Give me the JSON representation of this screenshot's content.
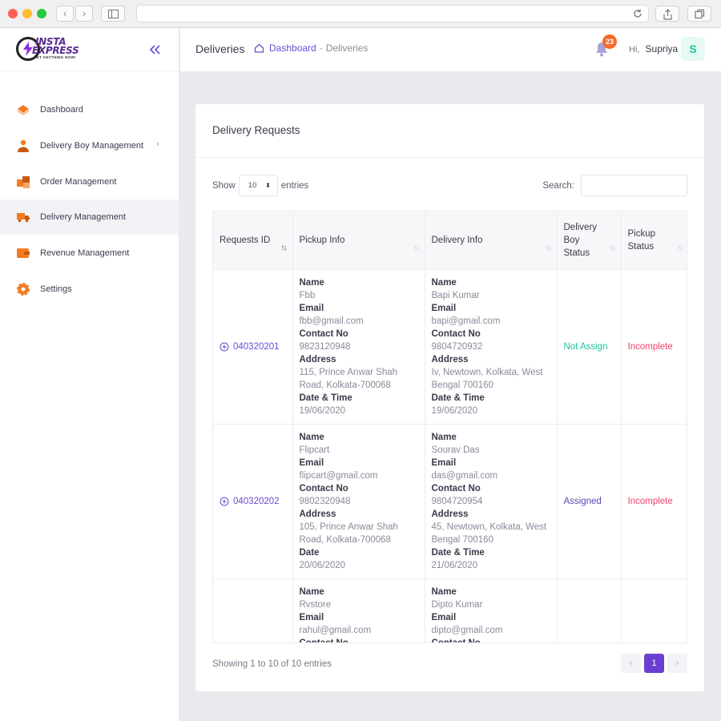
{
  "brand": {
    "line1": "INSTA",
    "line2": "EXPRESS",
    "tagline": "GET ANYTHING NOW!"
  },
  "sidebar": {
    "items": [
      {
        "label": "Dashboard",
        "icon": "diamond-icon",
        "color": "#f47a20"
      },
      {
        "label": "Delivery Boy Management",
        "icon": "delivery-boy-icon",
        "color": "#f47a20",
        "arrow": "›"
      },
      {
        "label": "Order Management",
        "icon": "boxes-icon",
        "color": "#f47a20"
      },
      {
        "label": "Delivery Management",
        "icon": "truck-icon",
        "color": "#f47a20"
      },
      {
        "label": "Revenue Management",
        "icon": "wallet-icon",
        "color": "#f47a20"
      },
      {
        "label": "Settings",
        "icon": "gear-icon",
        "color": "#f47a20"
      }
    ]
  },
  "header": {
    "title": "Deliveries",
    "breadcrumb_link": "Dashboard",
    "breadcrumb_sep": "-",
    "breadcrumb_current": "Deliveries",
    "notification_count": "23",
    "greeting": "Hi,",
    "user_name": "Supriya",
    "avatar_initial": "S"
  },
  "card": {
    "title": "Delivery Requests",
    "show_label": "Show",
    "entries_label": "entries",
    "page_length": "10",
    "search_label": "Search:",
    "search_value": "",
    "showing_text": "Showing 1 to 10 of 10 entries",
    "current_page": "1"
  },
  "table": {
    "headers": {
      "request_id": "Requests ID",
      "pickup": "Pickup Info",
      "delivery": "Delivery Info",
      "boy_status_1": "Delivery",
      "boy_status_2": "Boy",
      "boy_status_3": "Status",
      "pickup_status_1": "Pickup",
      "pickup_status_2": "Status"
    },
    "labels": {
      "name": "Name",
      "email": "Email",
      "contact": "Contact No",
      "address": "Address",
      "datetime": "Date & Time",
      "date": "Date"
    },
    "rows": [
      {
        "id": "040320201",
        "pickup": {
          "name": "Fbb",
          "email": "fbb@gmail.com",
          "contact": "9823120948",
          "address1": "115, Prince Anwar Shah",
          "address2": "Road, Kolkata-700068",
          "date_label": "Date & Time",
          "date": "19/06/2020"
        },
        "delivery": {
          "name": "Bapi Kumar",
          "email": "bapi@gmail.com",
          "contact": "9804720932",
          "address1": "Iv, Newtown, Kolkata, West",
          "address2": "Bengal 700160",
          "date": "19/06/2020"
        },
        "boy_status": "Not Assign",
        "boy_status_color": "#1bc5a0",
        "pickup_status": "Incomplete"
      },
      {
        "id": "040320202",
        "pickup": {
          "name": "Flipcart",
          "email": "flipcart@gmail.com",
          "contact": "9802320948",
          "address1": "105, Prince Anwar Shah",
          "address2": "Road, Kolkata-700068",
          "date_label": "Date",
          "date": "20/06/2020"
        },
        "delivery": {
          "name": "Sourav Das",
          "email": "das@gmail.com",
          "contact": "9804720954",
          "address1": "45, Newtown, Kolkata, West",
          "address2": "Bengal 700160",
          "date": "21/06/2020"
        },
        "boy_status": "Assigned",
        "boy_status_color": "#5a46b8",
        "pickup_status": "Incomplete"
      },
      {
        "id": "",
        "pickup": {
          "name": "Rvstore",
          "email": "rahul@gmail.com",
          "contact": ""
        },
        "delivery": {
          "name": "Dipto Kumar",
          "email": "dipto@gmail.com",
          "contact": ""
        },
        "boy_status": "",
        "pickup_status": ""
      }
    ]
  },
  "colors": {
    "accent": "#6a3fd1",
    "orange": "#f47a20",
    "green": "#1bc5a0",
    "red": "#f1416c"
  }
}
